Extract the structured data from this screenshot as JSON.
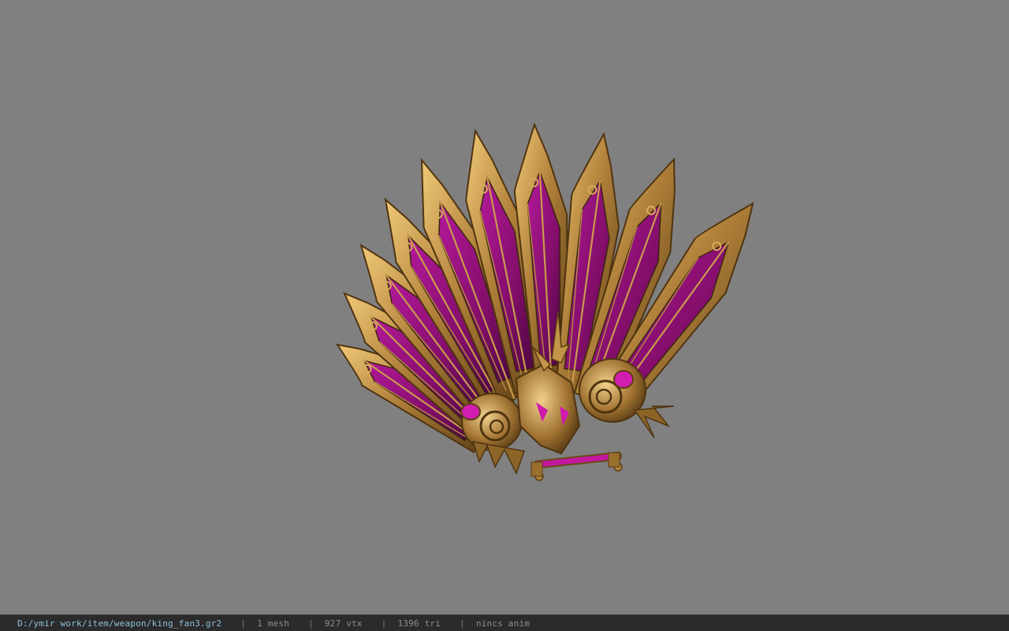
{
  "app": {
    "background_color": "#808080"
  },
  "model": {
    "icon": "fan-weapon-model",
    "colors": {
      "gold_light": "#e3b45f",
      "gold_mid": "#a97a32",
      "gold_dark": "#5e3e14",
      "magenta_light": "#c21aa3",
      "magenta_mid": "#8a0f70",
      "magenta_dark": "#4a0640"
    }
  },
  "statusbar": {
    "file_path": "D:/ymir work/item/weapon/king_fan3.gr2",
    "separator": "|",
    "mesh_count": "1 mesh",
    "vertex_count": "927 vtx",
    "triangle_count": "1396 tri",
    "anim_label": "nincs anim",
    "path_color": "#8fc1dc",
    "text_color": "#8e8e8e"
  }
}
